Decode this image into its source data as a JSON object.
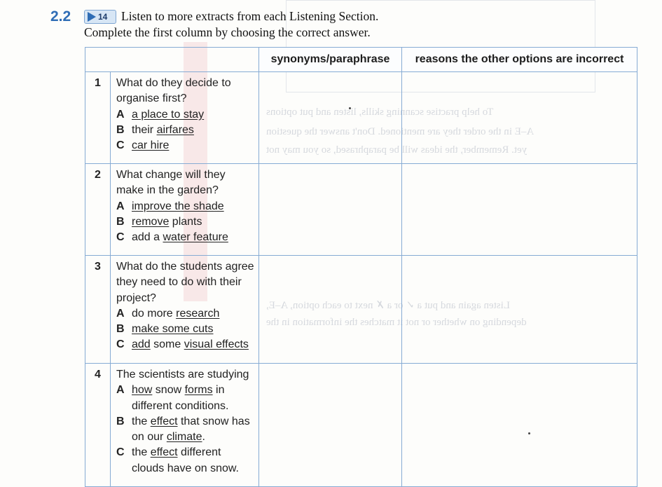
{
  "exercise": {
    "number": "2.2",
    "track": "14",
    "instruction_line1": "Listen to more extracts from each Listening Section.",
    "instruction_line2": "Complete the first column by choosing the correct answer."
  },
  "table": {
    "headers": [
      "",
      "synonyms/paraphrase",
      "reasons the other options are incorrect"
    ],
    "questions": [
      {
        "number": "1",
        "stem": "What do they decide to organise first?",
        "options": [
          {
            "letter": "A",
            "parts": [
              {
                "t": "a place to stay",
                "u": true
              }
            ]
          },
          {
            "letter": "B",
            "parts": [
              {
                "t": "their ",
                "u": false
              },
              {
                "t": "airfares",
                "u": true
              }
            ]
          },
          {
            "letter": "C",
            "parts": [
              {
                "t": "car hire",
                "u": true
              }
            ]
          }
        ]
      },
      {
        "number": "2",
        "stem": "What change will they make in the garden?",
        "options": [
          {
            "letter": "A",
            "parts": [
              {
                "t": "improve the shade",
                "u": true
              }
            ]
          },
          {
            "letter": "B",
            "parts": [
              {
                "t": "remove",
                "u": true
              },
              {
                "t": " plants",
                "u": false
              }
            ]
          },
          {
            "letter": "C",
            "parts": [
              {
                "t": "add a ",
                "u": false
              },
              {
                "t": "water feature",
                "u": true
              }
            ]
          }
        ]
      },
      {
        "number": "3",
        "stem": "What do the students agree they need to do with their project?",
        "options": [
          {
            "letter": "A",
            "parts": [
              {
                "t": "do more ",
                "u": false
              },
              {
                "t": "research",
                "u": true
              }
            ]
          },
          {
            "letter": "B",
            "parts": [
              {
                "t": "make some cuts",
                "u": true
              }
            ]
          },
          {
            "letter": "C",
            "parts": [
              {
                "t": "add",
                "u": true
              },
              {
                "t": " some ",
                "u": false
              },
              {
                "t": "visual effects",
                "u": true
              }
            ]
          }
        ]
      },
      {
        "number": "4",
        "stem": "The scientists are studying",
        "options": [
          {
            "letter": "A",
            "parts": [
              {
                "t": "how",
                "u": true
              },
              {
                "t": " snow ",
                "u": false
              },
              {
                "t": "forms",
                "u": true
              },
              {
                "t": " in different conditions.",
                "u": false
              }
            ]
          },
          {
            "letter": "B",
            "parts": [
              {
                "t": "the ",
                "u": false
              },
              {
                "t": "effect",
                "u": true
              },
              {
                "t": " that snow has on our ",
                "u": false
              },
              {
                "t": "climate",
                "u": true
              },
              {
                "t": ".",
                "u": false
              }
            ]
          },
          {
            "letter": "C",
            "parts": [
              {
                "t": "the ",
                "u": false
              },
              {
                "t": "effect",
                "u": true
              },
              {
                "t": " different clouds have on snow.",
                "u": false
              }
            ]
          }
        ]
      }
    ]
  },
  "colors": {
    "accent": "#2f6db5",
    "table_border": "#86abd4"
  }
}
